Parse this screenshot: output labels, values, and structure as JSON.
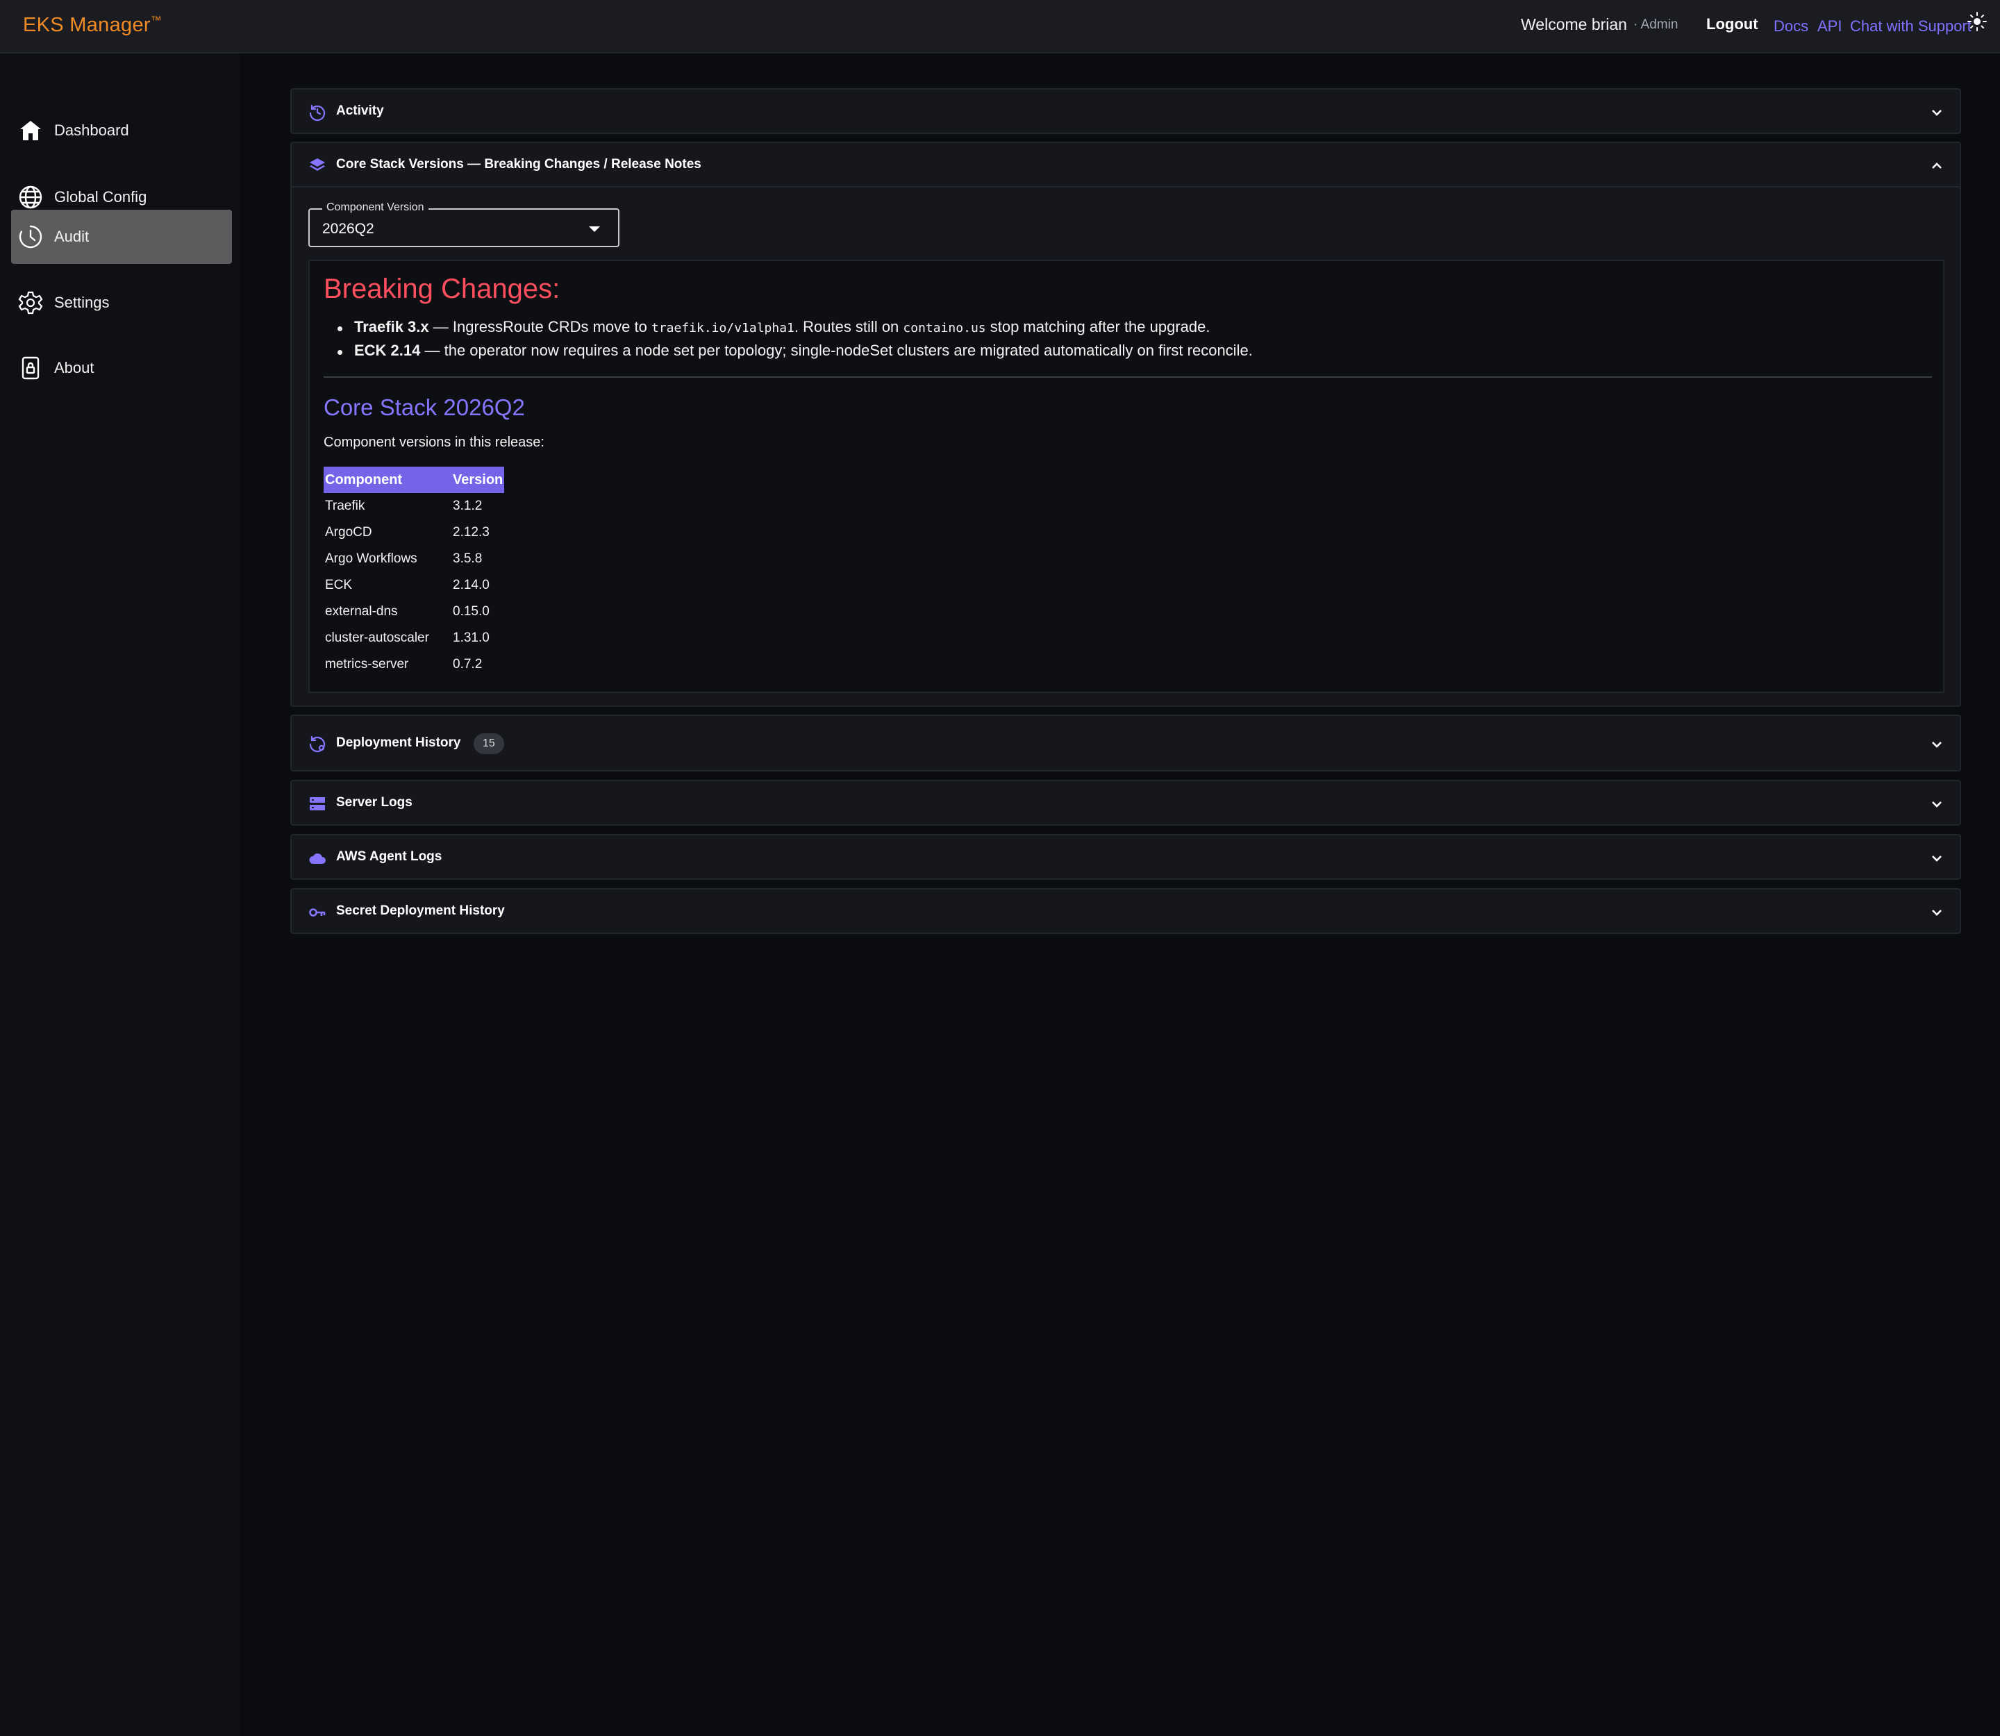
{
  "app": {
    "brand": "EKS Manager",
    "brand_tm": "™"
  },
  "topbar": {
    "welcome": "Welcome brian",
    "role": "· Admin",
    "logout": "Logout",
    "links": [
      "Docs",
      "API",
      "Chat with Support"
    ],
    "theme_icon": "sun-icon"
  },
  "sidebar": {
    "items": [
      {
        "label": "Dashboard",
        "icon": "home-icon",
        "active": false
      },
      {
        "label": "Global Config",
        "icon": "globe-icon",
        "active": false
      },
      {
        "label": "Audit",
        "icon": "clock-icon",
        "active": true
      },
      {
        "label": "Settings",
        "icon": "gear-icon",
        "active": false
      },
      {
        "label": "About",
        "icon": "lock-icon",
        "active": false
      }
    ]
  },
  "panels": {
    "activity": {
      "title": "Activity",
      "icon": "history-icon"
    },
    "core_stack": {
      "title": "Core Stack Versions — Breaking Changes / Release Notes",
      "icon": "layers-icon",
      "select_label": "Component Version",
      "select_value": "2026Q2",
      "breaking_title": "Breaking Changes:",
      "bullets": [
        {
          "bold": "Traefik 3.x",
          "text_a": " — IngressRoute CRDs move to ",
          "code_a": "traefik.io/v1alpha1",
          "text_b": ". Routes still on ",
          "code_b": "containo.us",
          "text_c": " stop matching after the upgrade."
        },
        {
          "bold": "ECK 2.14",
          "text_a": " — the operator now requires a node set per topology; single-nodeSet clusters are migrated automatically on first reconcile."
        }
      ],
      "release_title": "Core Stack 2026Q2",
      "release_sub": "Component versions in this release:",
      "table_headers": [
        "Component",
        "Version"
      ],
      "table_rows": [
        [
          "Traefik",
          "3.1.2"
        ],
        [
          "ArgoCD",
          "2.12.3"
        ],
        [
          "Argo Workflows",
          "3.5.8"
        ],
        [
          "ECK",
          "2.14.0"
        ],
        [
          "external-dns",
          "0.15.0"
        ],
        [
          "cluster-autoscaler",
          "1.31.0"
        ],
        [
          "metrics-server",
          "0.7.2"
        ]
      ]
    },
    "deployment_history": {
      "title": "Deployment History",
      "badge": "15",
      "icon": "restore-icon"
    },
    "server_logs": {
      "title": "Server Logs",
      "icon": "server-icon"
    },
    "aws_agent_logs": {
      "title": "AWS Agent Logs",
      "icon": "cloud-icon"
    },
    "secret_deployment_history": {
      "title": "Secret Deployment History",
      "icon": "key-icon"
    }
  },
  "colors": {
    "accent": "#7f72ff",
    "brand": "#f08a24",
    "danger": "#ff4f5e"
  }
}
